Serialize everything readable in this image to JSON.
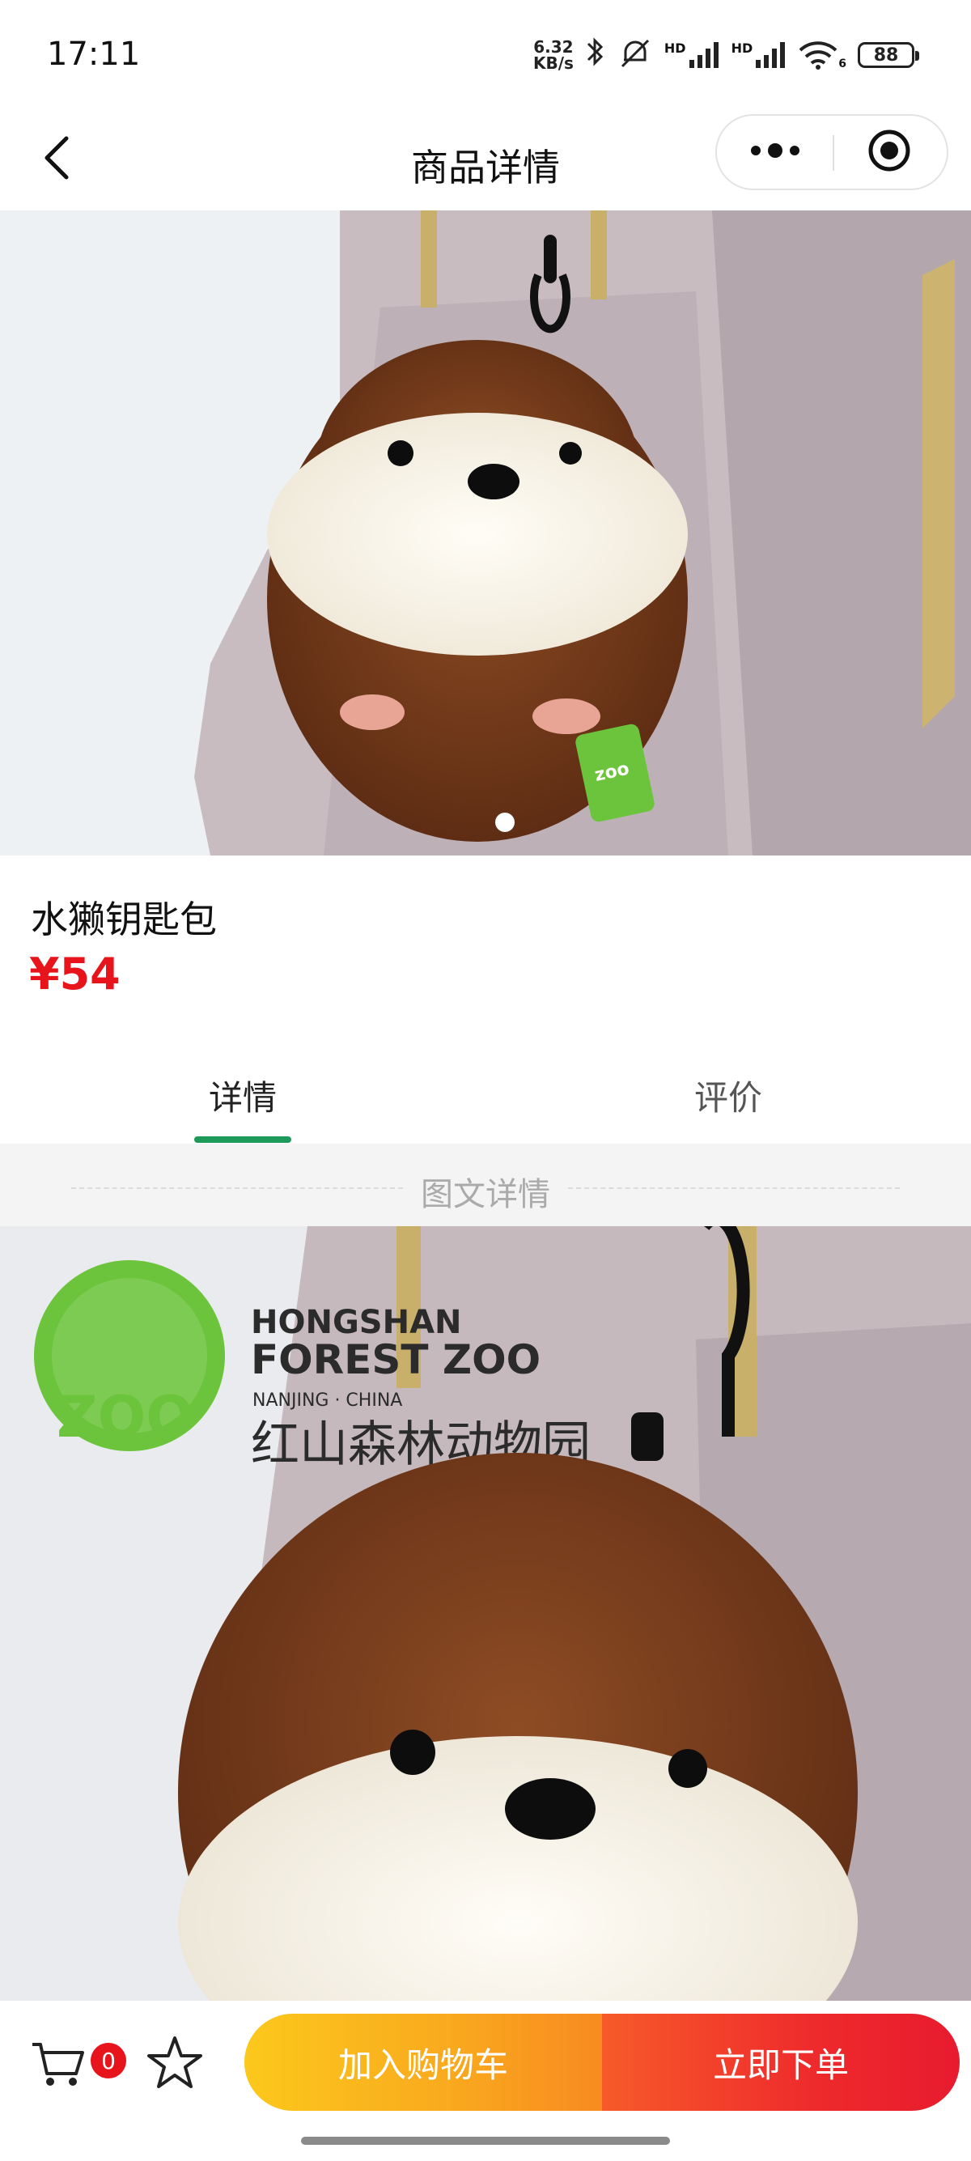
{
  "status_bar": {
    "time": "17:11",
    "net_speed_value": "6.32",
    "net_speed_unit": "KB/s",
    "signal_label_1": "HD",
    "signal_label_2": "HD",
    "wifi_label": "6",
    "battery": "88",
    "icons": [
      "bluetooth-icon",
      "mute-icon",
      "signal-icon",
      "wifi-icon",
      "battery-icon"
    ]
  },
  "nav": {
    "title": "商品详情",
    "icons": [
      "back-chevron-icon",
      "more-dots-icon",
      "target-icon"
    ]
  },
  "gallery": {
    "image_alt": "otter plush keychain on grey backpack",
    "current_index": 1,
    "total": 1
  },
  "product": {
    "name": "水獭钥匙包",
    "price": "¥54"
  },
  "tabs": {
    "detail": "详情",
    "review": "评价",
    "active": "detail"
  },
  "detail_section": {
    "label": "图文详情",
    "logo_title_1": "HONGSHAN",
    "logo_title_2": "FOREST ZOO",
    "logo_subtitle": "NANJING · CHINA",
    "logo_cn": "红山森林动物园"
  },
  "bottom_bar": {
    "cart_count": "0",
    "add_to_cart": "加入购物车",
    "buy_now": "立即下单",
    "icons": [
      "cart-icon",
      "star-icon"
    ]
  },
  "colors": {
    "price": "#e8141c",
    "tab_indicator": "#1d9a5a",
    "add_cart_gradient": [
      "#fcc81c",
      "#f88a20"
    ],
    "buy_now_gradient": [
      "#f75a2a",
      "#e71b2e"
    ]
  }
}
